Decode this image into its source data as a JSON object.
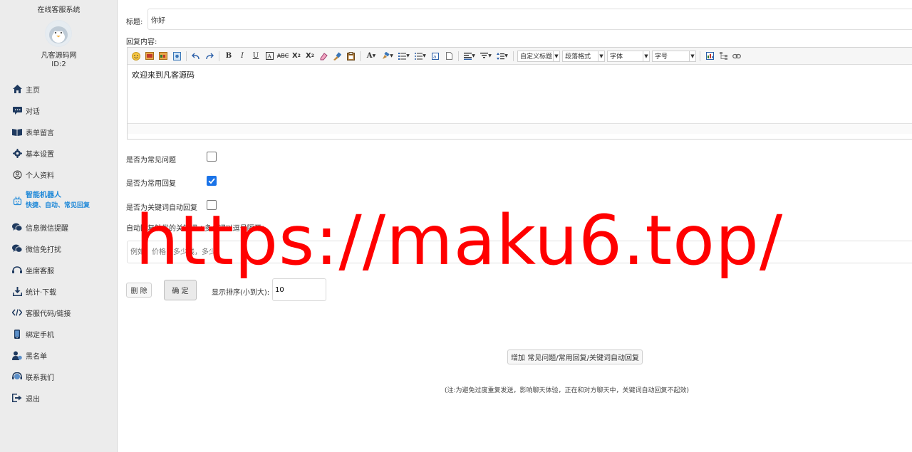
{
  "sidebar": {
    "brand": "在线客服系统",
    "shop_name": "凡客源码网",
    "shop_id": "ID:2",
    "items": [
      {
        "label": "主页",
        "icon": "home-icon"
      },
      {
        "label": "对话",
        "icon": "chat-icon"
      },
      {
        "label": "表单留言",
        "icon": "book-icon"
      },
      {
        "label": "基本设置",
        "icon": "gear-icon"
      },
      {
        "label": "个人资料",
        "icon": "user-circle-icon"
      },
      {
        "label": "智能机器人",
        "sublabel": "快捷、自动、常见回复",
        "icon": "robot-icon",
        "active": true
      },
      {
        "label": "信息微信提醒",
        "icon": "wechat-icon"
      },
      {
        "label": "微信免打扰",
        "icon": "wechat-mute-icon"
      },
      {
        "label": "坐席客服",
        "icon": "headset-icon"
      },
      {
        "label": "统计·下载",
        "icon": "download-icon"
      },
      {
        "label": "客服代码/链接",
        "icon": "code-icon"
      },
      {
        "label": "绑定手机",
        "icon": "phone-icon"
      },
      {
        "label": "黑名单",
        "icon": "blacklist-icon"
      },
      {
        "label": "联系我们",
        "icon": "contact-icon"
      },
      {
        "label": "退出",
        "icon": "logout-icon"
      }
    ]
  },
  "form": {
    "title_label": "标题:",
    "title_value": "你好",
    "content_label": "回复内容:",
    "editor_text": "欢迎来到凡客源码",
    "toolbar": {
      "custom_title": "自定义标题",
      "paragraph": "段落格式",
      "font": "字体",
      "font_size": "字号"
    },
    "faq_label": "是否为常见问题",
    "faq_checked": false,
    "common_label": "是否为常用回复",
    "common_checked": true,
    "keyword_auto_label": "是否为关键词自动回复",
    "keyword_auto_checked": false,
    "keywords_label": "自动回复触发的关键词 / 多个词以逗号隔开：",
    "keywords_placeholder": "例如：价格，多少钱，多少",
    "delete_button": "删 除",
    "confirm_button": "确 定",
    "sort_label": "显示排序(小到大):",
    "sort_value": "10",
    "add_button": "增加 常见问题/常用回复/关键词自动回复",
    "note": "(注:为避免过度重复发送，影响聊天体验，正在和对方聊天中，关键词自动回复不起效)"
  },
  "watermark": "https://maku6.top/",
  "colors": {
    "accent": "#1e88d8",
    "checkbox_on": "#1a73e8",
    "watermark": "#ff0000",
    "sidebar_bg": "#ececec"
  }
}
